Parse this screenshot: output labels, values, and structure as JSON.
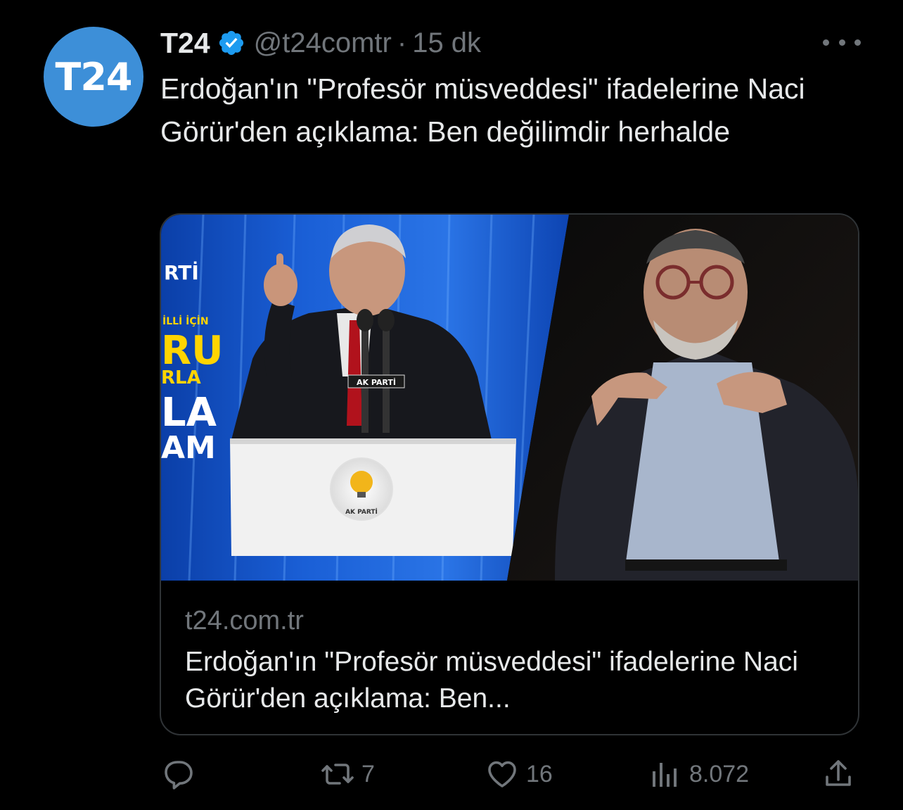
{
  "account": {
    "avatar_text": "T24",
    "display_name": "T24",
    "handle": "@t24comtr",
    "separator": "·",
    "time": "15 dk",
    "avatar_color": "#3d8fd8",
    "verified_color": "#1d9bf0"
  },
  "tweet": {
    "text": "Erdoğan'ın \"Profesör müsveddesi\" ifadelerine Naci Görür'den açıklama: Ben değilimdir herhalde"
  },
  "card": {
    "domain": "t24.com.tr",
    "title": "Erdoğan'ın \"Profesör müsveddesi\" ifadelerine Naci Görür'den açıklama: Ben...",
    "media": {
      "left_sign_lines": [
        "RTİ",
        "RU",
        "RLA",
        "LA",
        "AM"
      ],
      "left_sign_small": "İLLİ İÇİN",
      "podium_logo_text": "AK PARTİ",
      "tie_clip_text": "AK PARTİ"
    }
  },
  "actions": {
    "reply": {
      "icon": "reply-icon",
      "count": ""
    },
    "retweet": {
      "icon": "retweet-icon",
      "count": "7"
    },
    "like": {
      "icon": "heart-icon",
      "count": "16"
    },
    "views": {
      "icon": "views-icon",
      "count": "8.072"
    },
    "share": {
      "icon": "share-icon",
      "count": ""
    }
  }
}
